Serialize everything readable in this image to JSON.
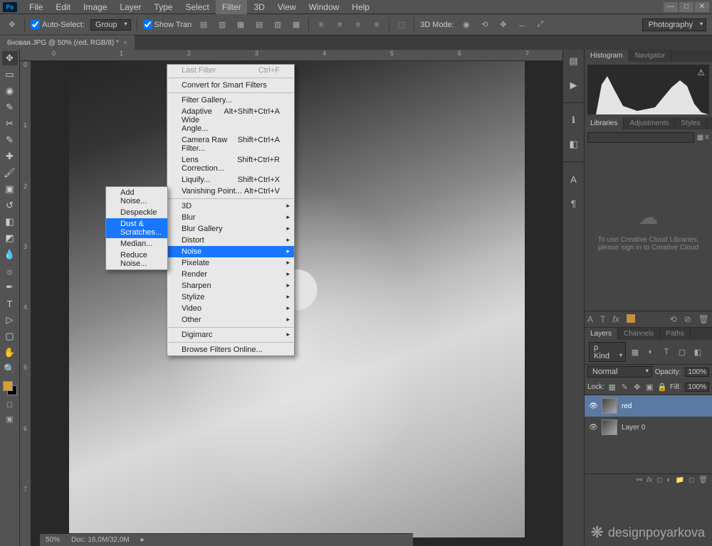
{
  "app": {
    "logo": "Ps"
  },
  "menu": {
    "items": [
      "File",
      "Edit",
      "Image",
      "Layer",
      "Type",
      "Select",
      "Filter",
      "3D",
      "View",
      "Window",
      "Help"
    ]
  },
  "filter_menu": {
    "last_filter": "Last Filter",
    "last_filter_sc": "Ctrl+F",
    "convert": "Convert for Smart Filters",
    "gallery": "Filter Gallery...",
    "awa": "Adaptive Wide Angle...",
    "awa_sc": "Alt+Shift+Ctrl+A",
    "craw": "Camera Raw Filter...",
    "craw_sc": "Shift+Ctrl+A",
    "lens": "Lens Correction...",
    "lens_sc": "Shift+Ctrl+R",
    "liq": "Liquify...",
    "liq_sc": "Shift+Ctrl+X",
    "vp": "Vanishing Point...",
    "vp_sc": "Alt+Ctrl+V",
    "g_3d": "3D",
    "g_blur": "Blur",
    "g_blurg": "Blur Gallery",
    "g_distort": "Distort",
    "g_noise": "Noise",
    "g_pixelate": "Pixelate",
    "g_render": "Render",
    "g_sharpen": "Sharpen",
    "g_stylize": "Stylize",
    "g_video": "Video",
    "g_other": "Other",
    "digimarc": "Digimarc",
    "browse": "Browse Filters Online..."
  },
  "noise_menu": {
    "add": "Add Noise...",
    "despeckle": "Despeckle",
    "dust": "Dust & Scratches...",
    "median": "Median...",
    "reduce": "Reduce Noise..."
  },
  "options": {
    "autosel": "Auto-Select:",
    "autosel_mode": "Group",
    "showtrans": "Show Tran",
    "mode3d": "3D Mode:",
    "workspace": "Photography"
  },
  "doc": {
    "tab": "6новая.JPG @ 50% (red, RGB/8) *"
  },
  "ruler_h": [
    "0",
    "1",
    "2",
    "3",
    "4",
    "5",
    "6",
    "7"
  ],
  "ruler_v": [
    "0",
    "1",
    "2",
    "3",
    "4",
    "5",
    "6",
    "7"
  ],
  "panels": {
    "histogram_tab": "Histogram",
    "navigator_tab": "Navigator",
    "libraries_tab": "Libraries",
    "adjustments_tab": "Adjustments",
    "styles_tab": "Styles",
    "lib_msg1": "To use Creative Cloud Libraries,",
    "lib_msg2": "please sign in to Creative Cloud",
    "layers_tab": "Layers",
    "channels_tab": "Channels",
    "paths_tab": "Paths",
    "kind_label": "Kind",
    "blend": "Normal",
    "opacity_label": "Opacity:",
    "opacity_val": "100%",
    "lock_label": "Lock:",
    "fill_label": "Fill:",
    "fill_val": "100%",
    "layer1": "red",
    "layer2": "Layer 0"
  },
  "status": {
    "zoom": "50%",
    "docinfo": "Doc: 16,0M/32,0M"
  },
  "watermark": "designpoyarkova"
}
